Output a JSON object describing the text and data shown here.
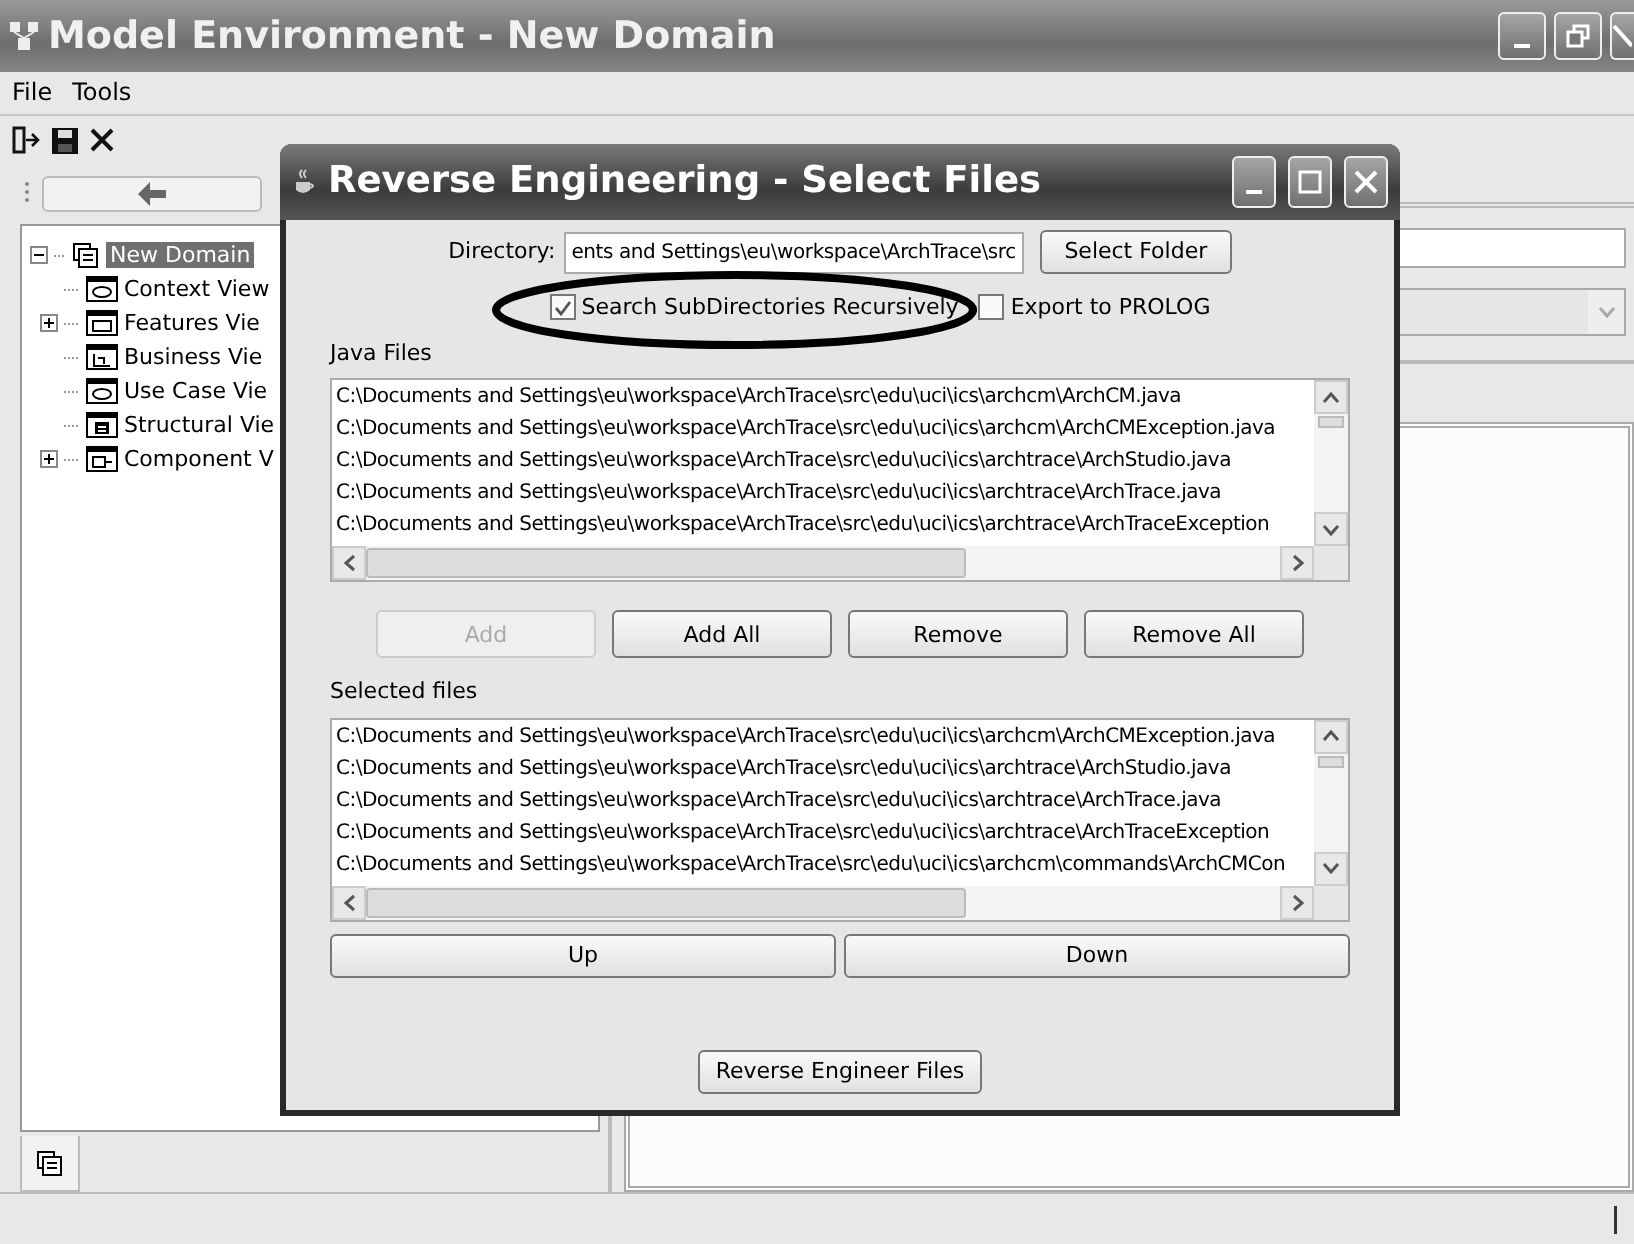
{
  "window": {
    "title": "Model Environment - New Domain"
  },
  "menu": [
    "File",
    "Tools"
  ],
  "tree": {
    "label": "New Domain",
    "selected": true,
    "expanded": true,
    "children": [
      {
        "label": "Context View",
        "kind": "context",
        "expandable": false
      },
      {
        "label": "Features Vie",
        "kind": "features",
        "expandable": true
      },
      {
        "label": "Business Vie",
        "kind": "business",
        "expandable": false
      },
      {
        "label": "Use Case Vie",
        "kind": "context",
        "expandable": false
      },
      {
        "label": "Structural Vie",
        "kind": "structural",
        "expandable": false
      },
      {
        "label": "Component V",
        "kind": "component",
        "expandable": true
      }
    ]
  },
  "dialog": {
    "title": "Reverse Engineering - Select Files",
    "directory": {
      "label": "Directory:",
      "value": "ents and Settings\\eu\\workspace\\ArchTrace\\src"
    },
    "select_folder_button": "Select Folder",
    "options": [
      {
        "label": "Search SubDirectories Recursively",
        "checked": true,
        "circled": true
      },
      {
        "label": "Export to PROLOG",
        "checked": false,
        "circled": false
      }
    ],
    "java_files": {
      "label": "Java Files",
      "items": [
        "C:\\Documents and Settings\\eu\\workspace\\ArchTrace\\src\\edu\\uci\\ics\\archcm\\ArchCM.java",
        "C:\\Documents and Settings\\eu\\workspace\\ArchTrace\\src\\edu\\uci\\ics\\archcm\\ArchCMException.java",
        "C:\\Documents and Settings\\eu\\workspace\\ArchTrace\\src\\edu\\uci\\ics\\archtrace\\ArchStudio.java",
        "C:\\Documents and Settings\\eu\\workspace\\ArchTrace\\src\\edu\\uci\\ics\\archtrace\\ArchTrace.java",
        "C:\\Documents and Settings\\eu\\workspace\\ArchTrace\\src\\edu\\uci\\ics\\archtrace\\ArchTraceException"
      ]
    },
    "buttons": [
      {
        "label": "Add",
        "disabled": true
      },
      {
        "label": "Add All",
        "disabled": false
      },
      {
        "label": "Remove",
        "disabled": false
      },
      {
        "label": "Remove All",
        "disabled": false
      }
    ],
    "selected_files": {
      "label": "Selected files",
      "items": [
        "C:\\Documents and Settings\\eu\\workspace\\ArchTrace\\src\\edu\\uci\\ics\\archcm\\ArchCMException.java",
        "C:\\Documents and Settings\\eu\\workspace\\ArchTrace\\src\\edu\\uci\\ics\\archtrace\\ArchStudio.java",
        "C:\\Documents and Settings\\eu\\workspace\\ArchTrace\\src\\edu\\uci\\ics\\archtrace\\ArchTrace.java",
        "C:\\Documents and Settings\\eu\\workspace\\ArchTrace\\src\\edu\\uci\\ics\\archtrace\\ArchTraceException",
        "C:\\Documents and Settings\\eu\\workspace\\ArchTrace\\src\\edu\\uci\\ics\\archcm\\commands\\ArchCMCon"
      ]
    },
    "order_buttons": [
      "Up",
      "Down"
    ],
    "submit_button": "Reverse Engineer Files"
  }
}
